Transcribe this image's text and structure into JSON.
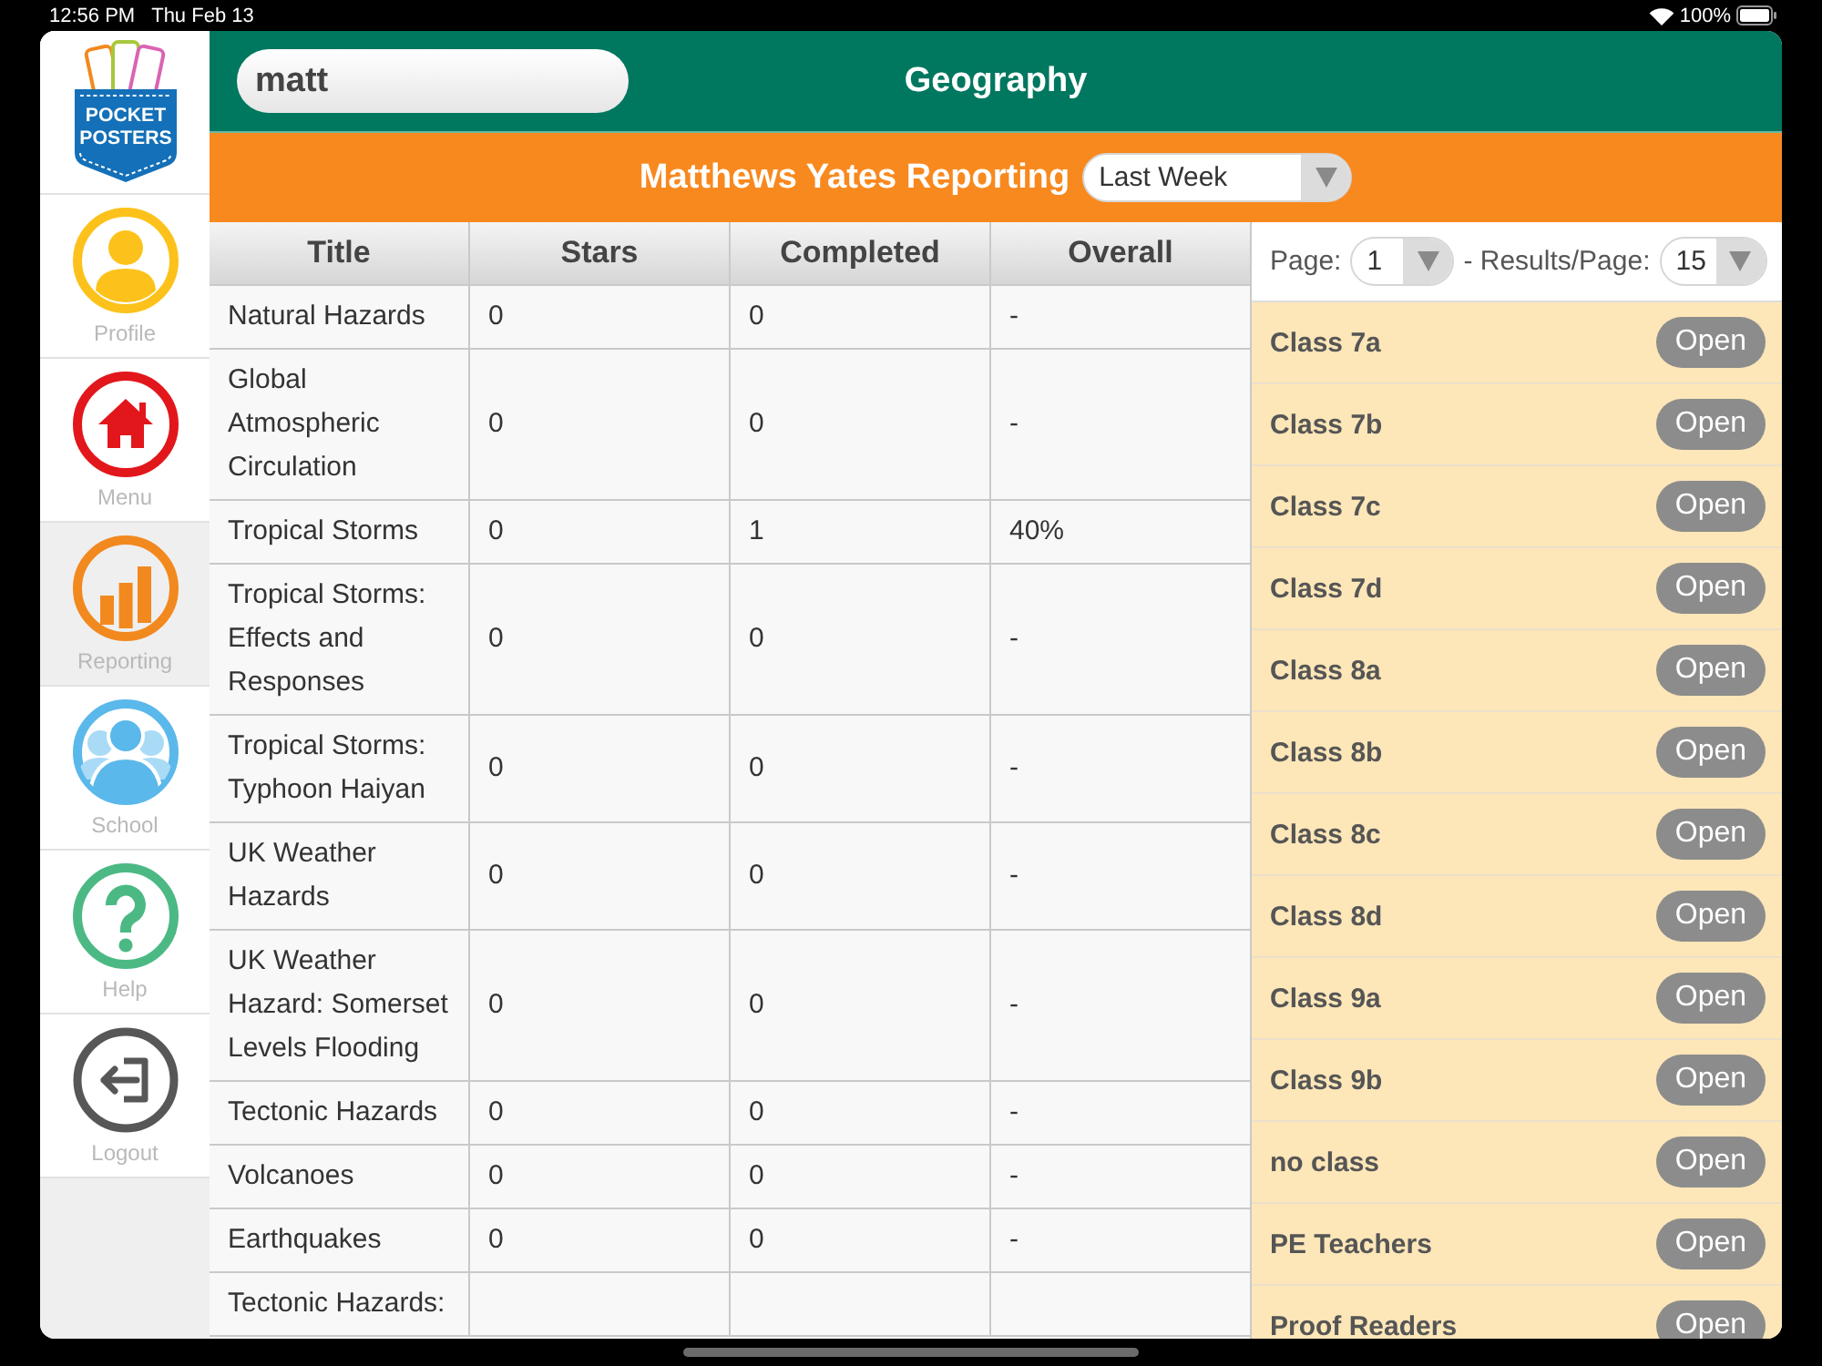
{
  "status_bar": {
    "time": "12:56 PM",
    "date": "Thu Feb 13",
    "battery": "100%"
  },
  "sidebar": {
    "logo": [
      "POCKET",
      "POSTERS"
    ],
    "items": [
      {
        "kind": "person",
        "label": "Profile",
        "selected": false
      },
      {
        "kind": "house",
        "label": "Menu",
        "selected": false
      },
      {
        "kind": "chart",
        "label": "Reporting",
        "selected": true
      },
      {
        "kind": "group",
        "label": "School",
        "selected": false
      },
      {
        "kind": "question",
        "label": "Help",
        "selected": false
      },
      {
        "kind": "exit",
        "label": "Logout",
        "selected": false
      }
    ]
  },
  "header": {
    "search": {
      "value": "matt"
    },
    "title": "Geography"
  },
  "report_bar": {
    "title": "Matthews Yates Reporting",
    "period": {
      "value": "Last Week"
    }
  },
  "table": {
    "columns": [
      "Title",
      "Stars",
      "Completed",
      "Overall"
    ],
    "rows": [
      [
        "Natural Hazards",
        "0",
        "0",
        "-"
      ],
      [
        "Global Atmospheric Circulation",
        "0",
        "0",
        "-"
      ],
      [
        "Tropical Storms",
        "0",
        "1",
        "40%"
      ],
      [
        "Tropical Storms: Effects and Responses",
        "0",
        "0",
        "-"
      ],
      [
        "Tropical Storms: Typhoon Haiyan",
        "0",
        "0",
        "-"
      ],
      [
        "UK Weather Hazards",
        "0",
        "0",
        "-"
      ],
      [
        "UK Weather Hazard: Somerset Levels Flooding",
        "0",
        "0",
        "-"
      ],
      [
        "Tectonic Hazards",
        "0",
        "0",
        "-"
      ],
      [
        "Volcanoes",
        "0",
        "0",
        "-"
      ],
      [
        "Earthquakes",
        "0",
        "0",
        "-"
      ],
      [
        "Tectonic Hazards:"
      ]
    ]
  },
  "class_panel": {
    "pager": {
      "page_label": "Page:",
      "page": "1",
      "per_page_label": "- Results/Page:",
      "per_page": "15"
    },
    "classes": [
      {
        "name": "Class 7a",
        "action": "Open"
      },
      {
        "name": "Class 7b",
        "action": "Open"
      },
      {
        "name": "Class 7c",
        "action": "Open"
      },
      {
        "name": "Class 7d",
        "action": "Open"
      },
      {
        "name": "Class 8a",
        "action": "Open"
      },
      {
        "name": "Class 8b",
        "action": "Open"
      },
      {
        "name": "Class 8c",
        "action": "Open"
      },
      {
        "name": "Class 8d",
        "action": "Open"
      },
      {
        "name": "Class 9a",
        "action": "Open"
      },
      {
        "name": "Class 9b",
        "action": "Open"
      },
      {
        "name": "no class",
        "action": "Open"
      },
      {
        "name": "PE Teachers",
        "action": "Open"
      },
      {
        "name": "Proof Readers",
        "action": "Open"
      }
    ]
  }
}
